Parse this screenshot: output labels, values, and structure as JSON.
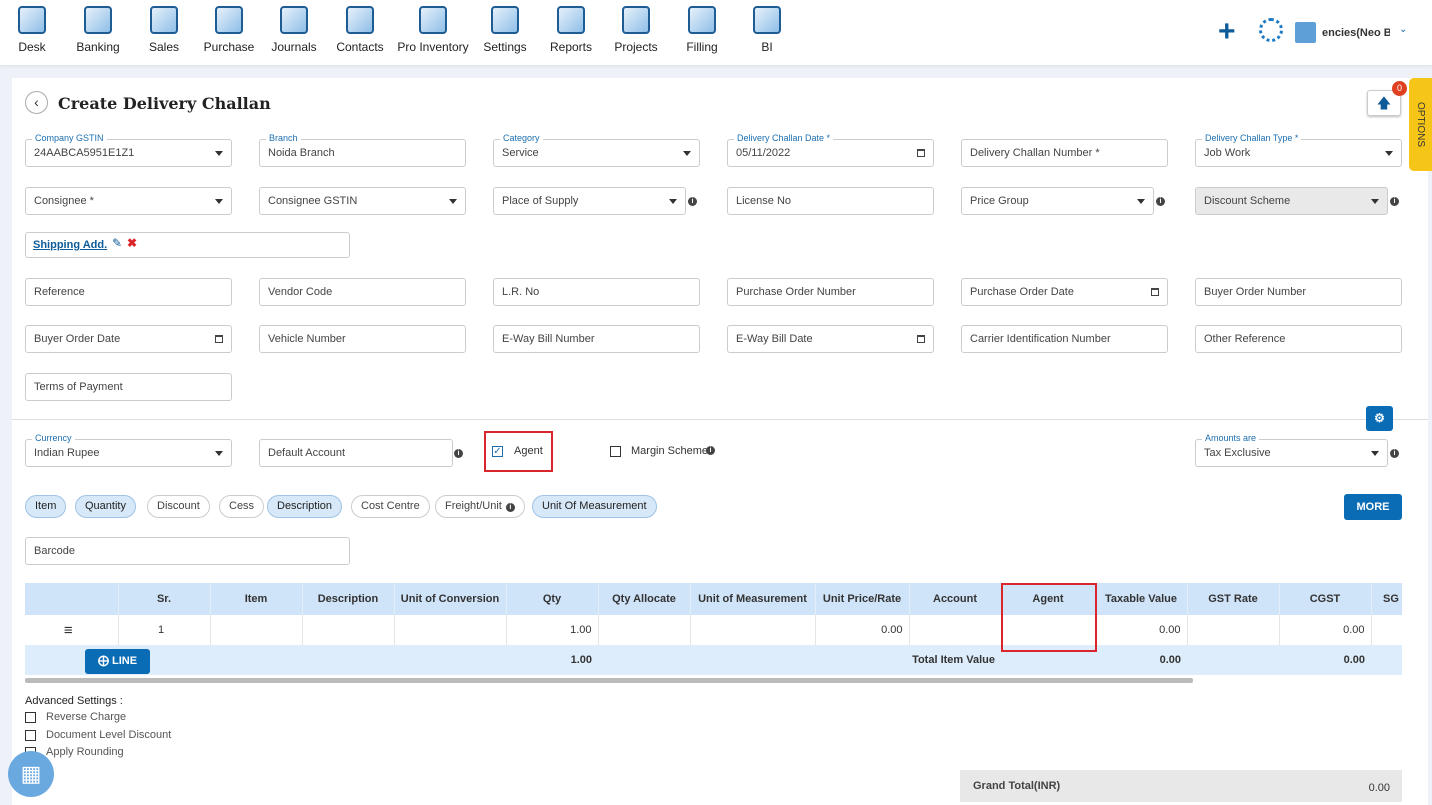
{
  "nav": [
    "Desk",
    "Banking",
    "Sales",
    "Purchase",
    "Journals",
    "Contacts",
    "Pro Inventory",
    "Settings",
    "Reports",
    "Projects",
    "Filling",
    "BI"
  ],
  "header": {
    "company": "encies(Neo Ba",
    "options": "OPTIONS",
    "badge": "0"
  },
  "page": {
    "title": "Create Delivery Challan"
  },
  "fields": [
    {
      "label": "Company GSTIN",
      "value": "24AABCA5951E1Z1",
      "type": "select"
    },
    {
      "label": "Branch",
      "value": "Noida Branch",
      "type": "text"
    },
    {
      "label": "Category",
      "value": "Service",
      "type": "select"
    },
    {
      "label": "Delivery Challan Date *",
      "value": "05/11/2022",
      "type": "date"
    },
    {
      "label": "",
      "value": "Delivery Challan Number *",
      "type": "text"
    },
    {
      "label": "Delivery Challan Type *",
      "value": "Job Work",
      "type": "select"
    },
    {
      "label": "",
      "value": "Consignee *",
      "type": "select"
    },
    {
      "label": "",
      "value": "Consignee GSTIN",
      "type": "select"
    },
    {
      "label": "",
      "value": "Place of Supply",
      "type": "select",
      "info": true
    },
    {
      "label": "",
      "value": "License No",
      "type": "text"
    },
    {
      "label": "",
      "value": "Price Group",
      "type": "select",
      "info": true
    },
    {
      "label": "",
      "value": "Discount Scheme",
      "type": "select",
      "info": true,
      "disabled": true
    },
    {
      "label": "",
      "value": "Reference",
      "type": "text"
    },
    {
      "label": "",
      "value": "Vendor Code",
      "type": "text"
    },
    {
      "label": "",
      "value": "L.R. No",
      "type": "text"
    },
    {
      "label": "",
      "value": "Purchase Order Number",
      "type": "text"
    },
    {
      "label": "",
      "value": "Purchase Order Date",
      "type": "date"
    },
    {
      "label": "",
      "value": "Buyer Order Number",
      "type": "text"
    },
    {
      "label": "",
      "value": "Buyer Order Date",
      "type": "date"
    },
    {
      "label": "",
      "value": "Vehicle Number",
      "type": "text"
    },
    {
      "label": "",
      "value": "E-Way Bill Number",
      "type": "text"
    },
    {
      "label": "",
      "value": "E-Way Bill Date",
      "type": "date"
    },
    {
      "label": "",
      "value": "Carrier Identification Number",
      "type": "text"
    },
    {
      "label": "",
      "value": "Other Reference",
      "type": "text"
    },
    {
      "label": "",
      "value": "Terms of Payment",
      "type": "text"
    }
  ],
  "shipping": {
    "label": "Shipping Add."
  },
  "currency": {
    "label": "Currency",
    "value": "Indian Rupee"
  },
  "default_account": "Default Account",
  "agent": {
    "label": "Agent",
    "checked": true
  },
  "margin": {
    "label": "Margin Scheme",
    "checked": false
  },
  "amounts": {
    "label": "Amounts are",
    "value": "Tax Exclusive"
  },
  "pills": [
    {
      "label": "Item",
      "on": true
    },
    {
      "label": "Quantity",
      "on": true
    },
    {
      "label": "Discount",
      "on": false
    },
    {
      "label": "Cess",
      "on": false
    },
    {
      "label": "Description",
      "on": true
    },
    {
      "label": "Cost Centre",
      "on": false
    },
    {
      "label": "Freight/Unit",
      "on": false,
      "info": true
    },
    {
      "label": "Unit Of Measurement",
      "on": true
    }
  ],
  "more": "MORE",
  "barcode": "Barcode",
  "table": {
    "columns": [
      "",
      "Sr.",
      "Item",
      "Description",
      "Unit of Conversion",
      "Qty",
      "Qty Allocate",
      "Unit of Measurement",
      "Unit Price/Rate",
      "Account",
      "Agent",
      "Taxable Value",
      "GST Rate",
      "CGST",
      "SG"
    ],
    "row": [
      "",
      "1",
      "",
      "",
      "",
      "1.00",
      "",
      "",
      "0.00",
      "",
      "",
      "0.00",
      "",
      "0.00",
      ""
    ],
    "footer": {
      "line_button": "LINE",
      "qty": "1.00",
      "total_label": "Total Item Value",
      "taxable": "0.00",
      "cgst": "0.00"
    }
  },
  "advanced": {
    "title": "Advanced Settings :",
    "options": [
      "Reverse Charge",
      "Document Level Discount",
      "Apply Rounding"
    ]
  },
  "grand_total": {
    "label": "Grand Total(INR)",
    "value": "0.00"
  },
  "colors": {
    "accent": "#0b6cb6",
    "highlight": "#d9262c",
    "options_tab": "#f5c518"
  }
}
